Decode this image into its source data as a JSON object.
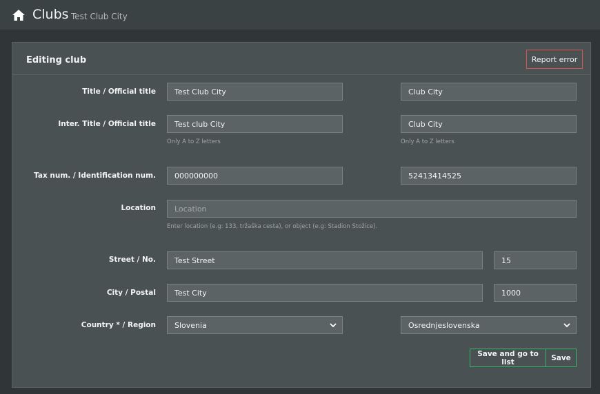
{
  "header": {
    "title": "Clubs",
    "subtitle": "Test Club City",
    "home_icon": "home-icon"
  },
  "panel": {
    "title": "Editing club",
    "report_label": "Report error"
  },
  "form": {
    "title_label": "Title / Official title",
    "title_value": "Test Club City",
    "official_title_value": "Club City",
    "inter_label": "Inter. Title / Official title",
    "inter_value": "Test club City",
    "inter_official_value": "Club City",
    "letters_hint": "Only A to Z letters",
    "tax_label": "Tax num. / Identification num.",
    "tax_value": "000000000",
    "id_value": "52413414525",
    "location_label": "Location",
    "location_placeholder": "Location",
    "location_value": "",
    "location_hint": "Enter location (e.g: 133, tržaška cesta), or object (e.g: Stadion Stožice).",
    "street_label": "Street / No.",
    "street_value": "Test Street",
    "number_value": "15",
    "city_label": "City / Postal",
    "city_value": "Test City",
    "postal_value": "1000",
    "country_label": "Country * / Region",
    "country_value": "Slovenia",
    "region_value": "Osrednjeslovenska"
  },
  "actions": {
    "save_go_label": "Save and go to list",
    "save_label": "Save"
  },
  "colors": {
    "accent_green": "#3cb371",
    "report_red": "#d9534f"
  }
}
